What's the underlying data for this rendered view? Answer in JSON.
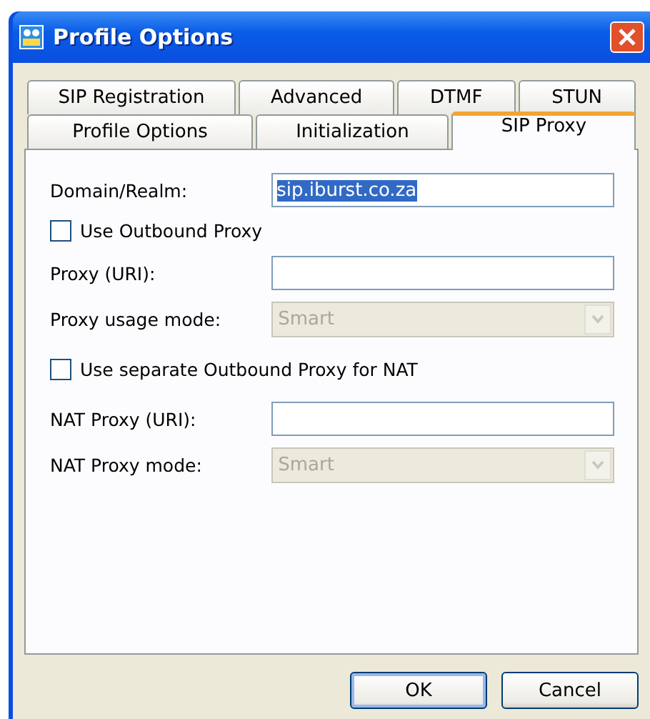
{
  "window": {
    "title": "Profile Options"
  },
  "tab_rows": [
    [
      {
        "label": "SIP Registration",
        "selected": false
      },
      {
        "label": "Advanced",
        "selected": false
      },
      {
        "label": "DTMF",
        "selected": false
      },
      {
        "label": "STUN",
        "selected": false
      }
    ],
    [
      {
        "label": "Profile Options",
        "selected": false
      },
      {
        "label": "Initialization",
        "selected": false
      },
      {
        "label": "SIP Proxy",
        "selected": true
      }
    ]
  ],
  "fields": [
    {
      "kind": "text",
      "label": "Domain/Realm:",
      "value": "sip.iburst.co.za"
    },
    {
      "kind": "checkbox",
      "label": "Use Outbound Proxy",
      "checked": false
    },
    {
      "kind": "text",
      "label": "Proxy (URI):"
    },
    {
      "kind": "select",
      "label": "Proxy usage mode:",
      "value": "Smart",
      "disabled": true
    },
    {
      "kind": "checkbox",
      "label": "Use separate Outbound Proxy for NAT",
      "checked": false
    },
    {
      "kind": "text",
      "label": "NAT Proxy (URI):"
    },
    {
      "kind": "select",
      "label": "NAT Proxy mode:",
      "value": "Smart",
      "disabled": true
    }
  ],
  "buttons": [
    "OK",
    "Cancel"
  ]
}
